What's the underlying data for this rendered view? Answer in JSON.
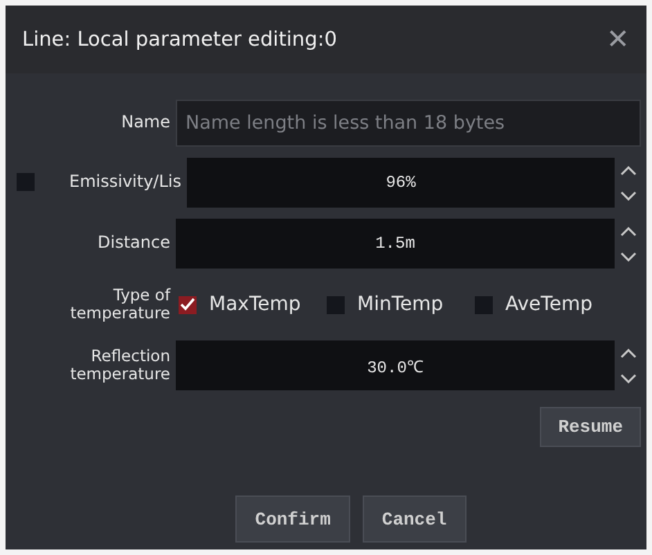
{
  "window": {
    "title": "Line: Local parameter editing:0",
    "close": "✕"
  },
  "name_field": {
    "label": "Name",
    "placeholder": "Name length is less than 18 bytes"
  },
  "emissivity": {
    "label": "Emissivity/Lis",
    "checked": false,
    "value": "96%"
  },
  "distance": {
    "label": "Distance",
    "value": "1.5m"
  },
  "temperature_type": {
    "label": "Type of temperature",
    "options": [
      {
        "label": "MaxTemp",
        "checked": true
      },
      {
        "label": "MinTemp",
        "checked": false
      },
      {
        "label": "AveTemp",
        "checked": false
      }
    ]
  },
  "reflection": {
    "label": "Reflection temperature",
    "value": "30.0℃"
  },
  "resume_button": "Resume",
  "buttons": [
    "Confirm",
    "Cancel"
  ]
}
